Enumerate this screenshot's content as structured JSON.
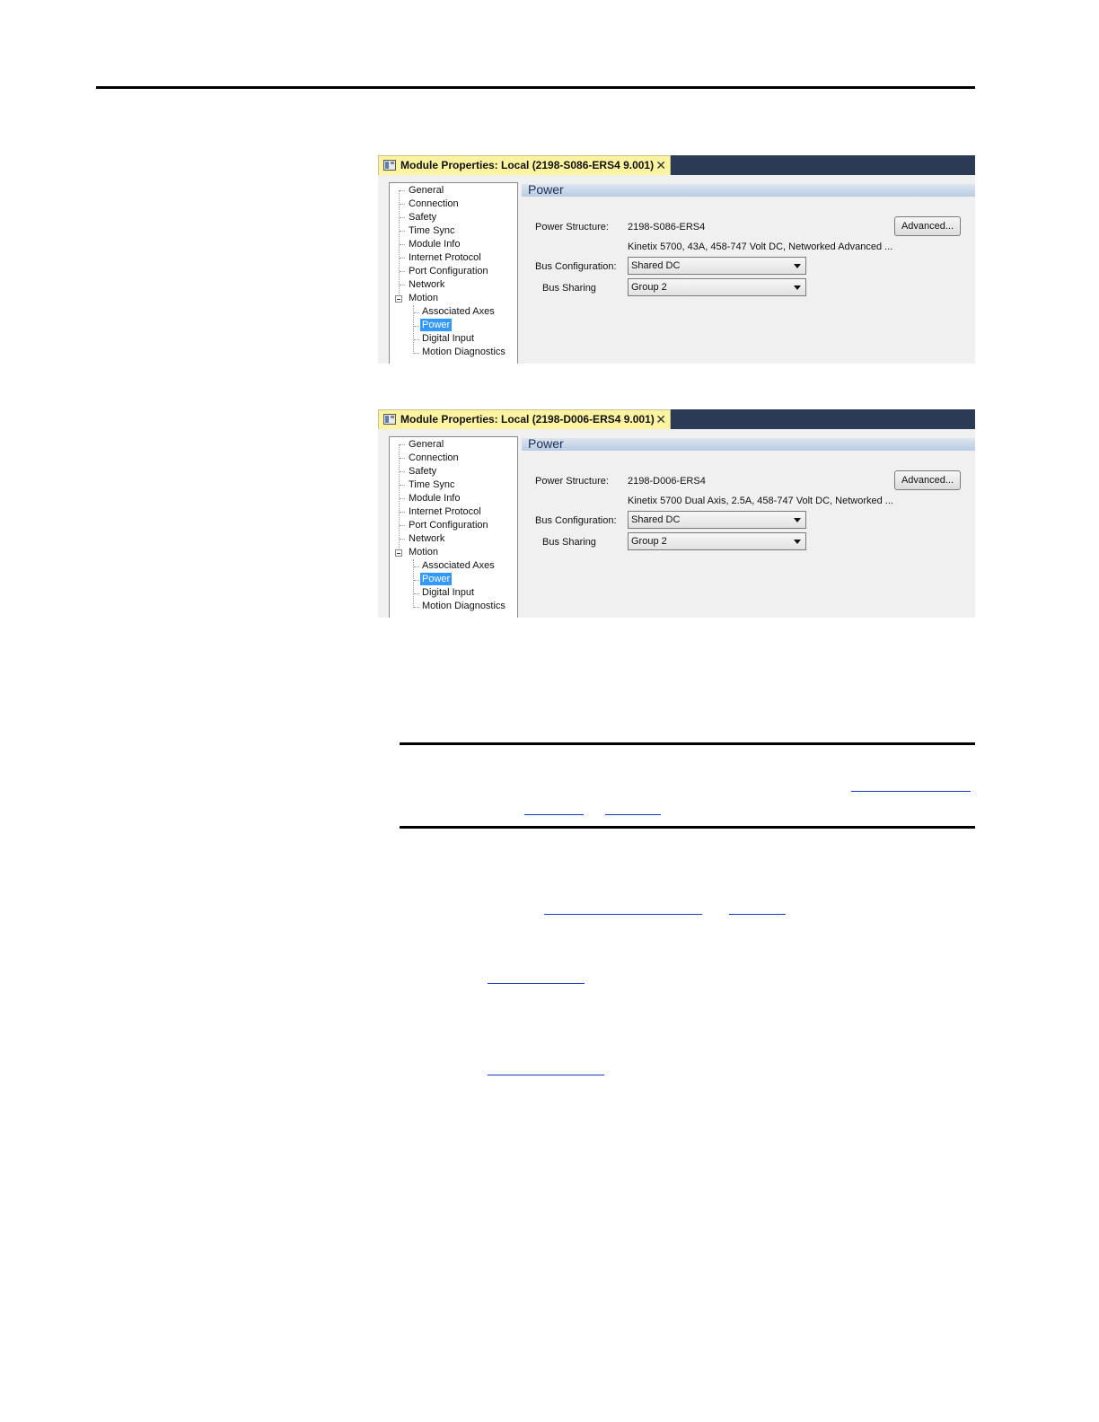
{
  "windows": [
    {
      "title": "Module Properties: Local (2198-S086-ERS4 9.001)",
      "close_glyph": "✕",
      "tree": {
        "items": [
          "General",
          "Connection",
          "Safety",
          "Time Sync",
          "Module Info",
          "Internet Protocol",
          "Port Configuration",
          "Network",
          "Motion"
        ],
        "sub_items": [
          "Associated Axes",
          "Power",
          "Digital Input",
          "Motion Diagnostics"
        ],
        "selected": "Power"
      },
      "panel": {
        "title": "Power",
        "power_structure_label": "Power Structure:",
        "power_structure_value": "2198-S086-ERS4",
        "description": "Kinetix 5700, 43A, 458-747 Volt DC, Networked Advanced ...",
        "advanced_button": "Advanced...",
        "bus_config_label": "Bus Configuration:",
        "bus_config_value": "Shared DC",
        "bus_sharing_label": "Bus Sharing",
        "bus_sharing_value": "Group 2"
      }
    },
    {
      "title": "Module Properties: Local (2198-D006-ERS4 9.001)",
      "close_glyph": "✕",
      "tree": {
        "items": [
          "General",
          "Connection",
          "Safety",
          "Time Sync",
          "Module Info",
          "Internet Protocol",
          "Port Configuration",
          "Network",
          "Motion"
        ],
        "sub_items": [
          "Associated Axes",
          "Power",
          "Digital Input",
          "Motion Diagnostics"
        ],
        "selected": "Power"
      },
      "panel": {
        "title": "Power",
        "power_structure_label": "Power Structure:",
        "power_structure_value": "2198-D006-ERS4",
        "description": "Kinetix 5700 Dual Axis, 2.5A, 458-747 Volt DC, Networked ...",
        "advanced_button": "Advanced...",
        "bus_config_label": "Bus Configuration:",
        "bus_config_value": "Shared DC",
        "bus_sharing_label": "Bus Sharing",
        "bus_sharing_value": "Group 2"
      }
    }
  ],
  "colors": {
    "title_tab": "#fdf4a2",
    "title_bar": "#2b3a55",
    "selection": "#3399ff",
    "link": "#1a3db5"
  }
}
